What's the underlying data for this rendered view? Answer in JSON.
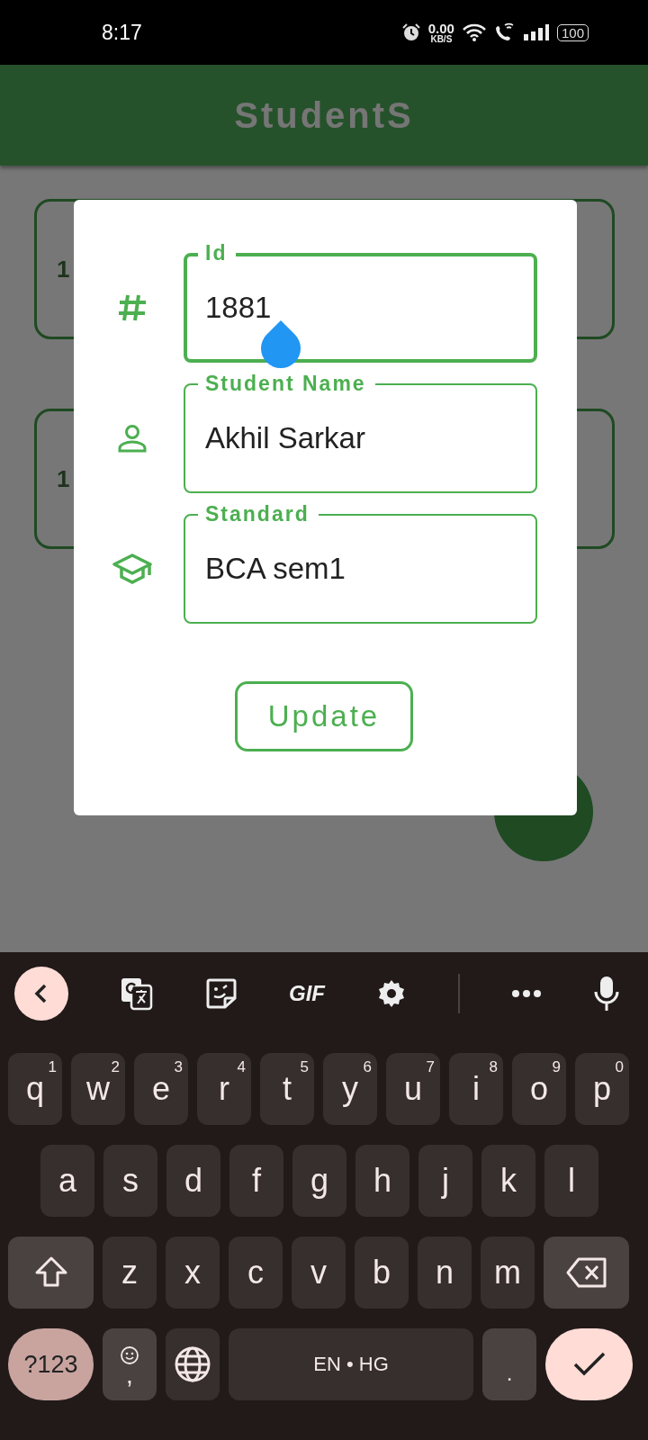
{
  "status_bar": {
    "time": "8:17",
    "net_speed": "0.00",
    "net_unit": "KB/S",
    "battery": "100"
  },
  "app_bar": {
    "title": "StudentS"
  },
  "background_cards": [
    {
      "text": "1"
    },
    {
      "text": "1"
    }
  ],
  "dialog": {
    "fields": [
      {
        "kind": "number",
        "label": "Id",
        "value": "1881",
        "focused": true
      },
      {
        "kind": "person",
        "label": "Student Name",
        "value": "Akhil Sarkar",
        "focused": false
      },
      {
        "kind": "school",
        "label": "Standard",
        "value": "BCA sem1",
        "focused": false
      }
    ],
    "button": "Update"
  },
  "keyboard": {
    "toolbar": [
      {
        "kind": "back"
      },
      {
        "kind": "translate"
      },
      {
        "kind": "sticker"
      },
      {
        "kind": "gif",
        "label": "GIF"
      },
      {
        "kind": "settings"
      },
      {
        "kind": "more"
      },
      {
        "kind": "mic"
      }
    ],
    "rows": [
      {
        "keys": [
          {
            "kind": "letter",
            "label": "q",
            "hint": "1"
          },
          {
            "kind": "letter",
            "label": "w",
            "hint": "2"
          },
          {
            "kind": "letter",
            "label": "e",
            "hint": "3"
          },
          {
            "kind": "letter",
            "label": "r",
            "hint": "4"
          },
          {
            "kind": "letter",
            "label": "t",
            "hint": "5"
          },
          {
            "kind": "letter",
            "label": "y",
            "hint": "6"
          },
          {
            "kind": "letter",
            "label": "u",
            "hint": "7"
          },
          {
            "kind": "letter",
            "label": "i",
            "hint": "8"
          },
          {
            "kind": "letter",
            "label": "o",
            "hint": "9"
          },
          {
            "kind": "letter",
            "label": "p",
            "hint": "0"
          }
        ]
      },
      {
        "keys": [
          {
            "kind": "letter",
            "label": "a"
          },
          {
            "kind": "letter",
            "label": "s"
          },
          {
            "kind": "letter",
            "label": "d"
          },
          {
            "kind": "letter",
            "label": "f"
          },
          {
            "kind": "letter",
            "label": "g"
          },
          {
            "kind": "letter",
            "label": "h"
          },
          {
            "kind": "letter",
            "label": "j"
          },
          {
            "kind": "letter",
            "label": "k"
          },
          {
            "kind": "letter",
            "label": "l"
          }
        ]
      },
      {
        "keys": [
          {
            "kind": "shift"
          },
          {
            "kind": "letter",
            "label": "z"
          },
          {
            "kind": "letter",
            "label": "x"
          },
          {
            "kind": "letter",
            "label": "c"
          },
          {
            "kind": "letter",
            "label": "v"
          },
          {
            "kind": "letter",
            "label": "b"
          },
          {
            "kind": "letter",
            "label": "n"
          },
          {
            "kind": "letter",
            "label": "m"
          },
          {
            "kind": "backspace"
          }
        ]
      },
      {
        "keys": [
          {
            "kind": "symbols",
            "label": "?123"
          },
          {
            "kind": "emoji",
            "label": ","
          },
          {
            "kind": "globe"
          },
          {
            "kind": "space",
            "label": "EN • HG"
          },
          {
            "kind": "period",
            "label": "."
          },
          {
            "kind": "enter"
          }
        ]
      }
    ]
  }
}
